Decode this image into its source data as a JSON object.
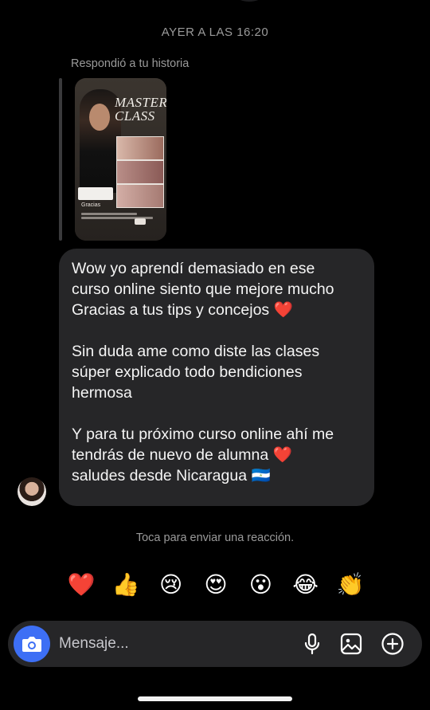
{
  "timestamp": "AYER A LAS 16:20",
  "reply_header": "Respondió a tu historia",
  "story": {
    "title_line1": "MASTER",
    "title_line2": "CLASS",
    "gracias": "Gracias"
  },
  "message": {
    "paragraphs": [
      "Wow yo aprendí demasiado en ese\ncurso online siento que mejore mucho\nGracias a tus tips y concejos ❤️",
      "Sin duda ame como diste las clases\nsúper explicado todo bendiciones\nhermosa",
      "Y para tu próximo curso online ahí me\ntendrás de nuevo de alumna ❤️\nsaludes desde Nicaragua 🇳🇮"
    ]
  },
  "reaction_hint": "Toca para enviar una reacción.",
  "reactions": [
    "❤️",
    "👍",
    "😢",
    "😍",
    "😮",
    "😂",
    "👏"
  ],
  "composer": {
    "placeholder": "Mensaje..."
  },
  "colors": {
    "background": "#000000",
    "bubble": "#262628",
    "camera_button": "#3d6ff5",
    "muted_text": "#9a9a9a"
  },
  "icons": {
    "camera": "camera-icon",
    "mic": "microphone-icon",
    "gallery": "gallery-icon",
    "plus": "plus-circle-icon"
  }
}
